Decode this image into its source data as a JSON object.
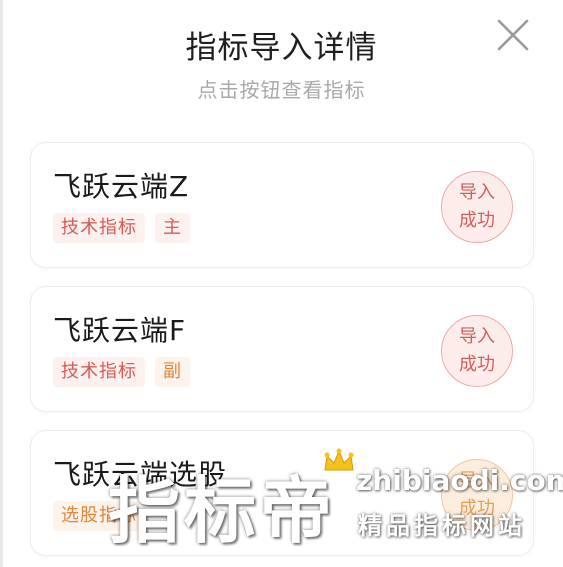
{
  "header": {
    "title": "指标导入详情",
    "subtitle": "点击按钮查看指标",
    "close_icon": "close-icon"
  },
  "cards": [
    {
      "name": "飞跃云端Z",
      "tags": [
        {
          "label": "技术指标",
          "color": "#d85b54"
        },
        {
          "label": "主",
          "color": "#d85b54"
        }
      ],
      "stamp": [
        "导入",
        "成功"
      ]
    },
    {
      "name": "飞跃云端F",
      "tags": [
        {
          "label": "技术指标",
          "color": "#d85b54"
        },
        {
          "label": "副",
          "color": "#e0873d"
        }
      ],
      "stamp": [
        "导入",
        "成功"
      ]
    },
    {
      "name": "飞跃云端选股",
      "tags": [
        {
          "label": "选股指标",
          "color": "#e0873d"
        }
      ],
      "stamp": [
        "导入",
        "成功"
      ]
    }
  ],
  "watermark": {
    "main": "指标帝",
    "url": "zhibiaodi.com",
    "slogan": "精品指标网站"
  },
  "colors": {
    "accent_red": "#d85b54",
    "accent_orange": "#e0873d",
    "stamp_red_bg": "#fdecec"
  }
}
